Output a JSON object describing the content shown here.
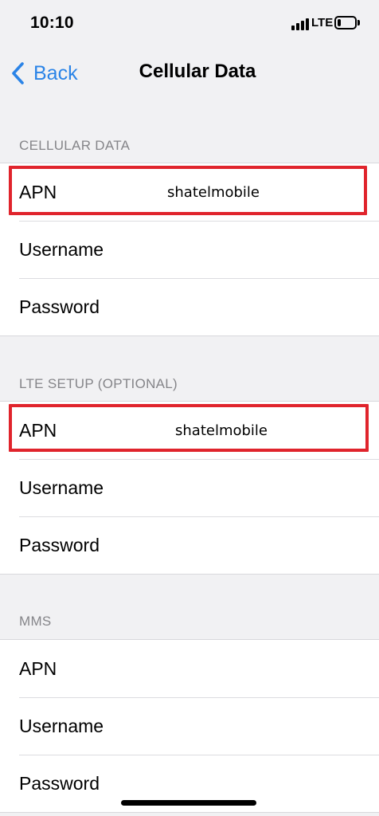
{
  "status_bar": {
    "time": "10:10",
    "network": "LTE",
    "signal_icon": "cellular-signal-icon",
    "battery_icon": "battery-icon",
    "battery_level": 0.2
  },
  "nav": {
    "back_label": "Back",
    "back_icon": "chevron-left-icon",
    "title": "Cellular Data",
    "accent_color": "#2b84e7"
  },
  "sections": [
    {
      "header": "CELLULAR DATA",
      "rows": [
        {
          "label": "APN",
          "value": "shatelmobile"
        },
        {
          "label": "Username",
          "value": ""
        },
        {
          "label": "Password",
          "value": ""
        }
      ]
    },
    {
      "header": "LTE SETUP (OPTIONAL)",
      "rows": [
        {
          "label": "APN",
          "value": "shatelmobile"
        },
        {
          "label": "Username",
          "value": ""
        },
        {
          "label": "Password",
          "value": ""
        }
      ]
    },
    {
      "header": "MMS",
      "rows": [
        {
          "label": "APN",
          "value": ""
        },
        {
          "label": "Username",
          "value": ""
        },
        {
          "label": "Password",
          "value": ""
        }
      ]
    }
  ],
  "highlight_color": "#e0242c"
}
